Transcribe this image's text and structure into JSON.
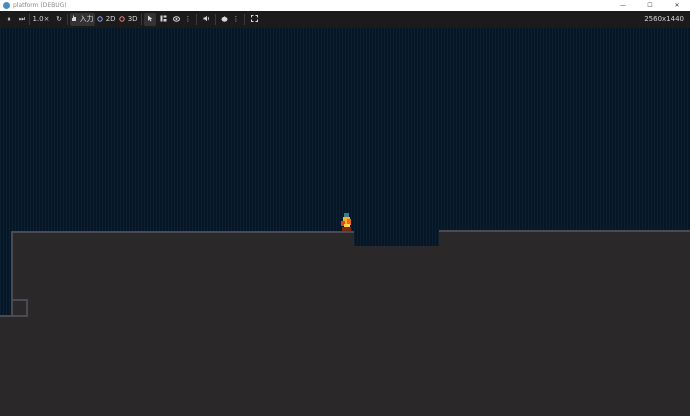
{
  "window": {
    "title": "platform (DEBUG)",
    "minimize_glyph": "—",
    "maximize_glyph": "☐",
    "close_glyph": "✕"
  },
  "toolbar": {
    "pause_glyph": "⏸",
    "step_glyph": "⏭",
    "speed": "1.0×",
    "reset_glyph": "↻",
    "input_label": "入力",
    "mode_2d": "2D",
    "mode_3d": "3D",
    "more_glyph": "⋮",
    "resolution": "2560x1440"
  },
  "icons": [
    "pause-icon",
    "step-icon",
    "reset-speed-icon",
    "input-hand-icon",
    "select-cursor-icon",
    "list-select-icon",
    "camera-icon",
    "audio-icon",
    "sound-icon",
    "menu-dots-icon",
    "fullscreen-icon"
  ],
  "colors": {
    "viewport_bg": "#061624",
    "ground": "#2a2828",
    "ground_edge": "#4a4a52",
    "player_body": "#f2b51a",
    "player_glow": "#e0421c",
    "player_head": "#3e7a8c"
  }
}
